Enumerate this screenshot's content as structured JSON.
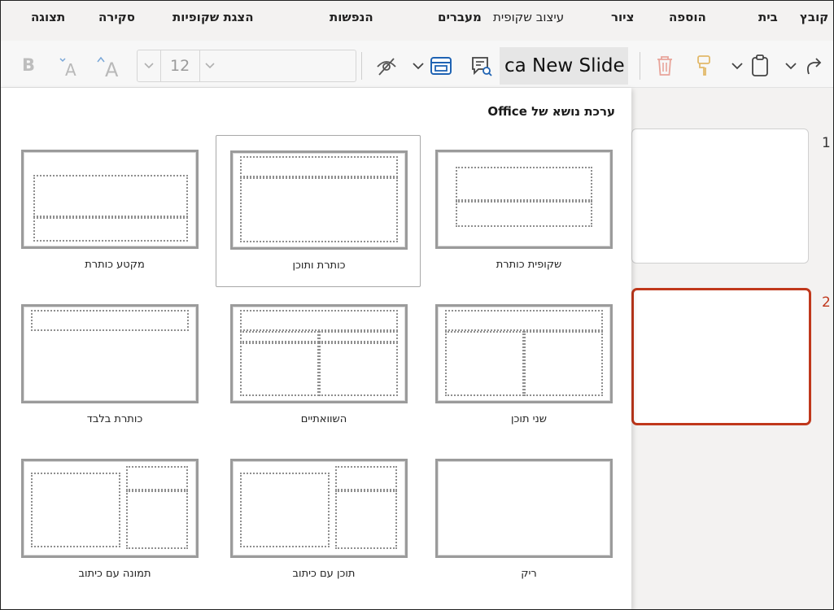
{
  "menu": {
    "tabs": [
      "קובץ",
      "בית",
      "הוספה",
      "ציור",
      "עיצוב שקופית",
      "מעברים",
      "הנפשות",
      "הצגת שקופיות",
      "סקירה",
      "תצוגה"
    ]
  },
  "ribbon": {
    "font_size": "12",
    "new_slide_label": "ca New Slide"
  },
  "gallery": {
    "title": "ערכת נושא של Office",
    "layouts": [
      "שקופית כותרת",
      "כותרת ותוכן",
      "מקטע      כותרת",
      "שני תוכן",
      "השוואתיים",
      "כותרת בלבד",
      "ריק",
      "תוכן עם כיתוב",
      "תמונה עם כיתוב"
    ]
  },
  "thumbnails": {
    "numbers": [
      "1",
      "2"
    ]
  },
  "icons": [
    "redo-icon",
    "clipboard-icon",
    "format-painter-icon",
    "delete-icon",
    "comment-search-icon",
    "layout-icon",
    "hide-icon",
    "increase-font-icon",
    "decrease-font-icon",
    "bold-icon"
  ],
  "colors": {
    "accent": "#c0381c",
    "ribbon_bg": "#f7f7f7",
    "menubar_bg": "#f3f2f1"
  }
}
